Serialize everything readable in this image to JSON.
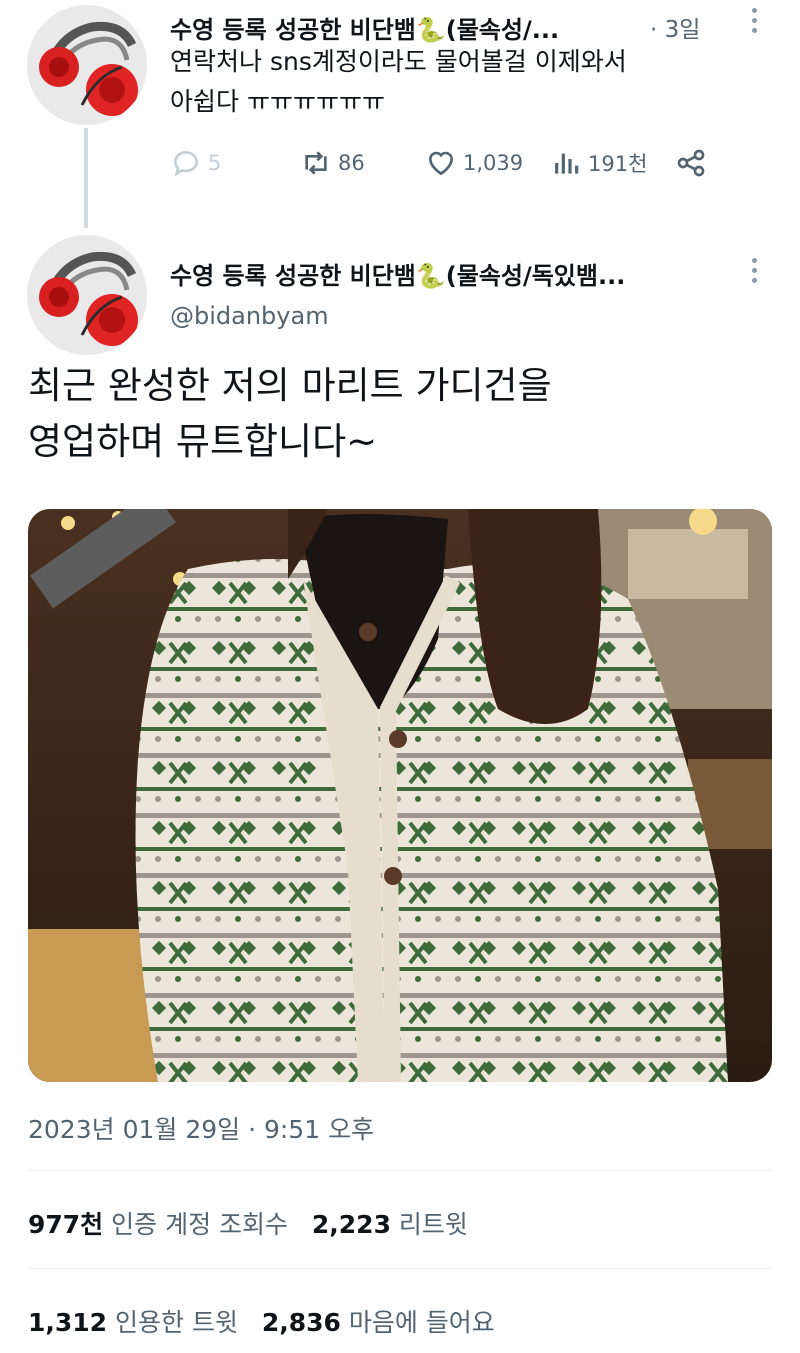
{
  "reply_tweet": {
    "display_name": "수영 등록 성공한 비단뱀🐍(물속성/...",
    "time": "· 3일",
    "text_line1": "연락처나 sns계정이라도 물어볼걸 이제와서",
    "text_line2": "아쉽다 ㅠㅠㅠㅠㅠㅠ",
    "replies": "5",
    "retweets": "86",
    "likes": "1,039",
    "views": "191천"
  },
  "main_tweet": {
    "display_name": "수영 등록 성공한 비단뱀🐍(물속성/독있뱀...",
    "handle": "@bidanbyam",
    "text_line1": "최근 완성한 저의 마리트 가디건을",
    "text_line2": "영업하며 뮤트합니다~",
    "timestamp": "2023년 01월 29일 · 9:51 오후",
    "views_count": "977천",
    "views_label": "인증 계정 조회수",
    "retweets_count": "2,223",
    "retweets_label": "리트윗",
    "quotes_count": "1,312",
    "quotes_label": "인용한 트윗",
    "likes_count": "2,836",
    "likes_label": "마음에 들어요"
  },
  "icons": [
    "reply-icon",
    "retweet-icon",
    "like-icon",
    "views-icon",
    "share-icon",
    "more-icon"
  ],
  "colors": {
    "text": "#0f1419",
    "muted": "#536471",
    "divider": "#eff3f4",
    "sweater_green": "#3f6b3a",
    "sweater_cream": "#ece6da"
  }
}
